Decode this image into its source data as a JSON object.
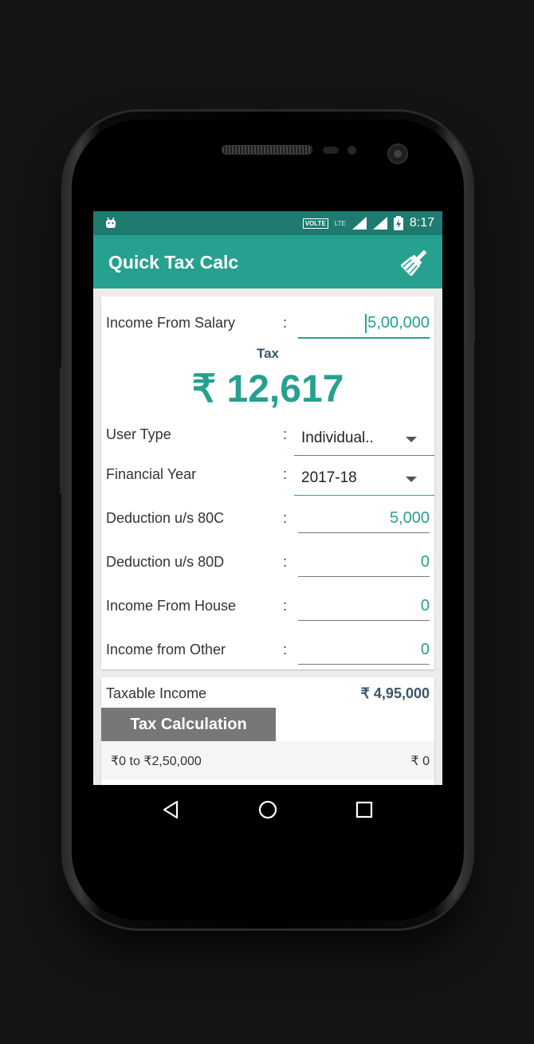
{
  "status_bar": {
    "volte": "VOLTE",
    "lte": "LTE",
    "time": "8:17"
  },
  "app_bar": {
    "title": "Quick Tax Calc",
    "clear_icon": "broom-icon"
  },
  "form": {
    "salary": {
      "label": "Income From Salary",
      "colon": ":",
      "value": "5,00,000"
    },
    "tax_label": "Tax",
    "tax_value": "₹ 12,617",
    "user_type": {
      "label": "User Type",
      "colon": ":",
      "value": "Individual.."
    },
    "financial_year": {
      "label": "Financial Year",
      "colon": ":",
      "value": "2017-18"
    },
    "deduction_80c": {
      "label": "Deduction u/s 80C",
      "colon": ":",
      "value": "5,000"
    },
    "deduction_80d": {
      "label": "Deduction u/s 80D",
      "colon": ":",
      "value": "0"
    },
    "income_house": {
      "label": "Income From House",
      "colon": ":",
      "value": "0"
    },
    "income_other": {
      "label": "Income from Other",
      "colon": ":",
      "value": "0"
    }
  },
  "summary": {
    "taxable_label": "Taxable Income",
    "taxable_value": "₹ 4,95,000",
    "tax_calc_button": "Tax Calculation",
    "slabs": [
      {
        "range": "₹0 to ₹2,50,000",
        "amount": "₹ 0"
      }
    ]
  },
  "colors": {
    "primary": "#26a08f",
    "primary_dark": "#1f7a70",
    "heading": "#3b5565"
  },
  "nav": {
    "icons": [
      "back-icon",
      "home-icon",
      "recents-icon"
    ]
  }
}
